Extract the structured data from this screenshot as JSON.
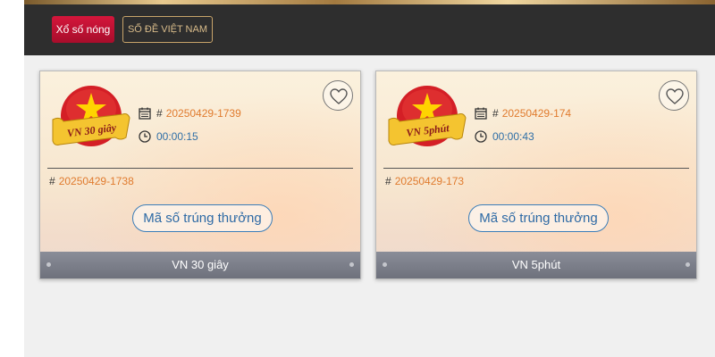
{
  "header": {
    "tabs": [
      {
        "label": "Xổ số nóng",
        "active": true
      },
      {
        "label": "SỐ ĐỀ VIỆT NAM",
        "active": false
      }
    ]
  },
  "colors": {
    "accent_red": "#c8102e",
    "gold": "#c8a46a",
    "issue_orange": "#e07b2e",
    "timer_blue": "#2f6fa7"
  },
  "cards": [
    {
      "logo_text": "VN 30 giây",
      "current_issue": "20250429-1739",
      "countdown": "00:00:15",
      "previous_issue": "20250429-1738",
      "button_label": "Mã số trúng thưởng",
      "footer_label": "VN 30 giây",
      "hash": "#"
    },
    {
      "logo_text": "VN 5phút",
      "current_issue": "20250429-174",
      "countdown": "00:00:43",
      "previous_issue": "20250429-173",
      "button_label": "Mã số trúng thưởng",
      "footer_label": "VN 5phút",
      "hash": "#"
    }
  ],
  "icons": [
    "calendar-icon",
    "clock-icon",
    "heart-icon",
    "star-icon"
  ]
}
